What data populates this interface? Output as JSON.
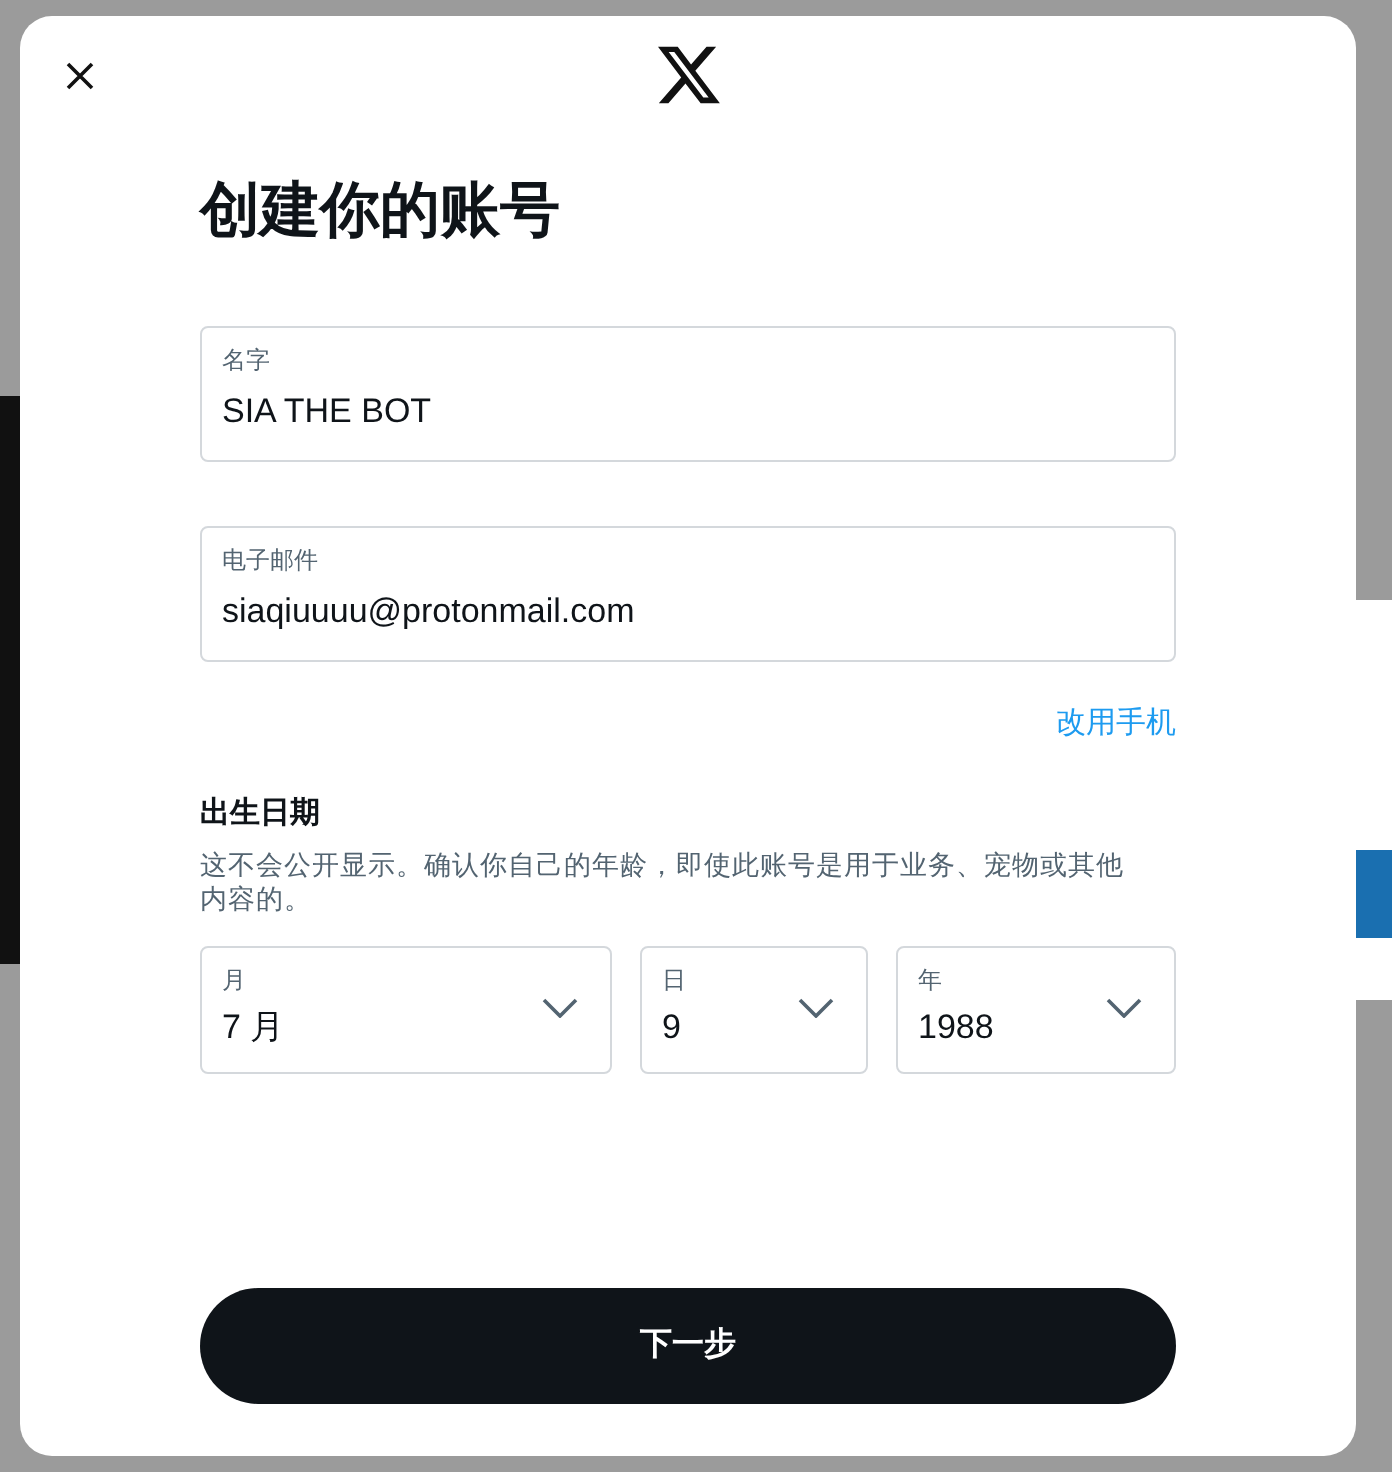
{
  "dialog": {
    "title": "创建你的账号"
  },
  "fields": [
    {
      "label": "名字",
      "value": "SIA THE BOT"
    },
    {
      "label": "电子邮件",
      "value": "siaqiuuuu@protonmail.com"
    }
  ],
  "switch_link": "改用手机",
  "birth_date": {
    "heading": "出生日期",
    "note": "这不会公开显示。确认你自己的年龄，即使此账号是用于业务、宠物或其他内容的。",
    "selects": [
      {
        "label": "月",
        "value": "7 月"
      },
      {
        "label": "日",
        "value": "9"
      },
      {
        "label": "年",
        "value": "1988"
      }
    ]
  },
  "next_button": "下一步"
}
